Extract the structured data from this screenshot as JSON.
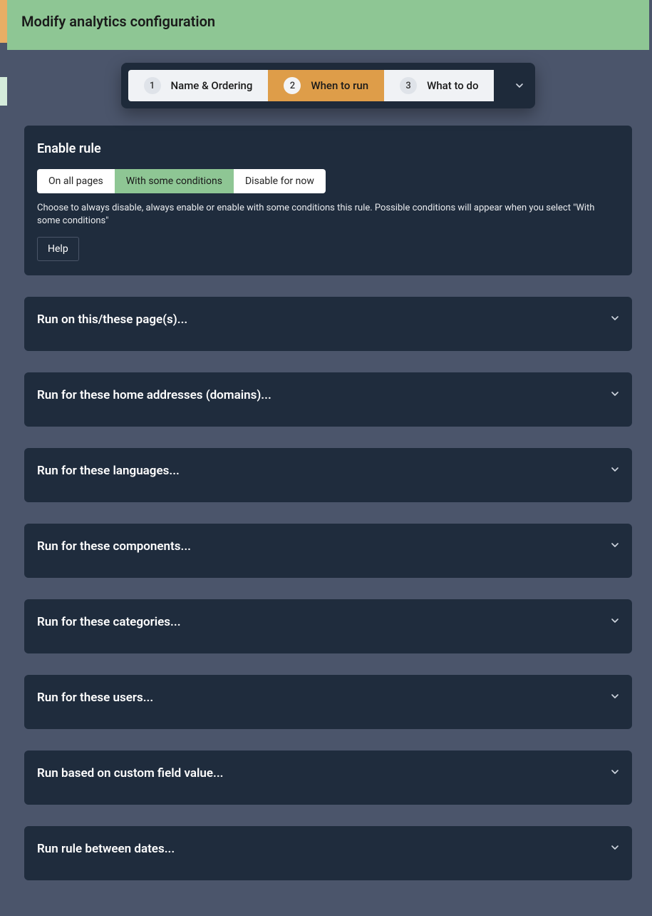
{
  "header": {
    "title": "Modify analytics configuration"
  },
  "stepper": {
    "steps": [
      {
        "num": "1",
        "label": "Name & Ordering"
      },
      {
        "num": "2",
        "label": "When to run"
      },
      {
        "num": "3",
        "label": "What to do"
      }
    ],
    "active_index": 1
  },
  "enable_rule": {
    "title": "Enable rule",
    "options": [
      {
        "label": "On all pages"
      },
      {
        "label": "With some conditions"
      },
      {
        "label": "Disable for now"
      }
    ],
    "selected_index": 1,
    "description": "Choose to always disable, always enable or enable with some conditions this rule. Possible conditions will appear when you select \"With some conditions\"",
    "help_label": "Help"
  },
  "accordions": [
    {
      "title": "Run on this/these page(s)..."
    },
    {
      "title": "Run for these home addresses (domains)..."
    },
    {
      "title": "Run for these languages..."
    },
    {
      "title": "Run for these components..."
    },
    {
      "title": "Run for these categories..."
    },
    {
      "title": "Run for these users..."
    },
    {
      "title": "Run based on custom field value..."
    },
    {
      "title": "Run rule between dates..."
    }
  ]
}
